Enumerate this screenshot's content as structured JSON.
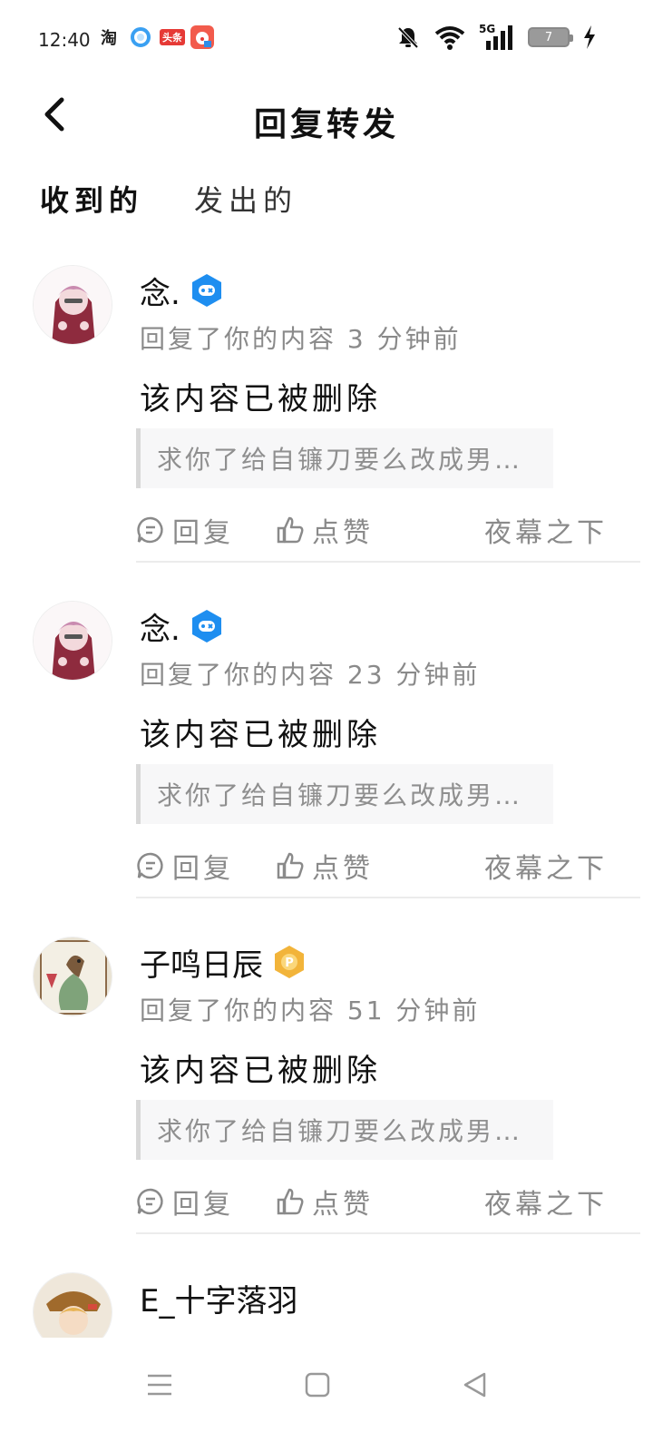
{
  "status_bar": {
    "time": "12:40",
    "apps": [
      "淘",
      "头条"
    ],
    "network": "5G",
    "battery": "7"
  },
  "header": {
    "title": "回复转发"
  },
  "tabs": [
    {
      "label": "收到的",
      "active": true
    },
    {
      "label": "发出的",
      "active": false
    }
  ],
  "colors": {
    "accent": "#23c7b0",
    "badge_blue": "#1e8ef0",
    "badge_gold": "#f2b43a",
    "muted": "#8a8a8a"
  },
  "feed": [
    {
      "username": "念.",
      "badge": "game-badge-icon",
      "meta": "回复了你的内容 3 分钟前",
      "content": "该内容已被删除",
      "quote": "求你了给自镰刀要么改成男…",
      "reply_label": "回复",
      "like_label": "点赞",
      "author": "夜幕之下"
    },
    {
      "username": "念.",
      "badge": "game-badge-icon",
      "meta": "回复了你的内容 23 分钟前",
      "content": "该内容已被删除",
      "quote": "求你了给自镰刀要么改成男…",
      "reply_label": "回复",
      "like_label": "点赞",
      "author": "夜幕之下"
    },
    {
      "username": "子鸣日辰",
      "badge": "gold-p-badge-icon",
      "meta": "回复了你的内容 51 分钟前",
      "content": "该内容已被删除",
      "quote": "求你了给自镰刀要么改成男…",
      "reply_label": "回复",
      "like_label": "点赞",
      "author": "夜幕之下"
    }
  ],
  "partial_item": {
    "username": "E_十字落羽"
  }
}
